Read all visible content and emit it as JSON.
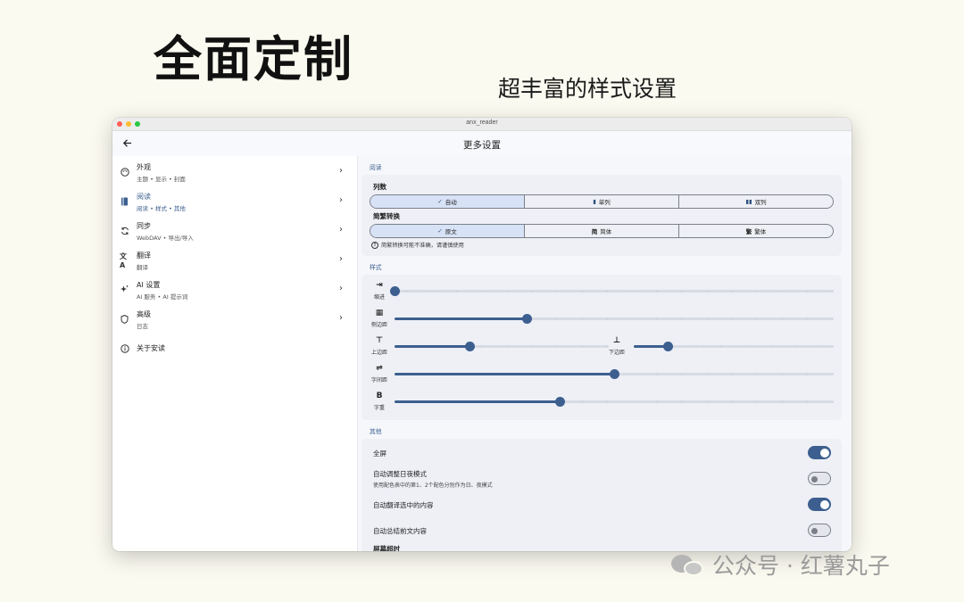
{
  "hero": {
    "title": "全面定制",
    "subtitle": "超丰富的样式设置"
  },
  "window": {
    "title": "anx_reader"
  },
  "appbar": {
    "title": "更多设置"
  },
  "sidebar": {
    "items": [
      {
        "icon": "palette-icon",
        "title": "外观",
        "subtitle": "主题 • 显示 • 封面"
      },
      {
        "icon": "book-icon",
        "title": "阅读",
        "subtitle": "阅读 • 样式 • 其他"
      },
      {
        "icon": "sync-icon",
        "title": "同步",
        "subtitle": "WebDAV • 导出/导入"
      },
      {
        "icon": "translate-icon",
        "title": "翻译",
        "subtitle": "翻译"
      },
      {
        "icon": "sparkle-icon",
        "title": "AI 设置",
        "subtitle": "AI 服务 • AI 提示词"
      },
      {
        "icon": "shield-icon",
        "title": "高级",
        "subtitle": "日志"
      },
      {
        "icon": "info-icon",
        "title": "关于安读",
        "subtitle": ""
      }
    ]
  },
  "reading": {
    "section_label": "阅读",
    "columns_label": "列数",
    "columns_options": [
      "自动",
      "单列",
      "双列"
    ],
    "columns_selected": "自动",
    "convert_label": "简繁转换",
    "convert_options": [
      "原文",
      "简体",
      "繁体"
    ],
    "convert_selected": "原文",
    "convert_warning": "简繁转换可能不准确，请谨慎使用"
  },
  "style": {
    "section_label": "样式",
    "indent_label": "缩进",
    "indent_value": 0.0,
    "side_margin_label": "侧边距",
    "side_margin_value": 0.3,
    "top_margin_label": "上边距",
    "top_margin_value": 0.35,
    "bottom_margin_label": "下边距",
    "bottom_margin_value": 0.17,
    "letter_spacing_label": "字间距",
    "letter_spacing_value": 0.5,
    "font_weight_label": "字重",
    "font_weight_value": 0.375
  },
  "other": {
    "section_label": "其他",
    "fullscreen_label": "全屏",
    "fullscreen_on": true,
    "auto_night_label": "自动调整日夜模式",
    "auto_night_desc": "使用配色表中的第1、2个配色分别作为日、夜模式",
    "auto_night_on": false,
    "auto_translate_label": "自动翻译选中的内容",
    "auto_translate_on": true,
    "auto_summary_label": "自动总结前文内容",
    "auto_summary_on": false,
    "screen_timeout_label": "屏幕超时"
  },
  "watermark": {
    "text": "公众号 · 红薯丸子"
  },
  "colors": {
    "accent": "#3c5f8f",
    "page_bg": "#fbfaf0"
  }
}
